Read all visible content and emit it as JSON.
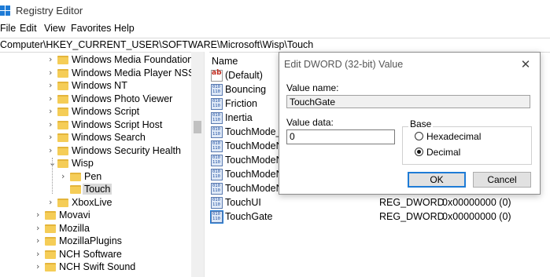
{
  "window": {
    "title": "Registry Editor"
  },
  "menu": [
    "File",
    "Edit",
    "View",
    "Favorites",
    "Help"
  ],
  "address": "Computer\\HKEY_CURRENT_USER\\SOFTWARE\\Microsoft\\Wisp\\Touch",
  "tree": [
    {
      "label": "Windows Media Foundation",
      "expand": "collapsed"
    },
    {
      "label": "Windows Media Player NSS",
      "expand": "collapsed"
    },
    {
      "label": "Windows NT",
      "expand": "collapsed"
    },
    {
      "label": "Windows Photo Viewer",
      "expand": "collapsed"
    },
    {
      "label": "Windows Script",
      "expand": "collapsed"
    },
    {
      "label": "Windows Script Host",
      "expand": "collapsed"
    },
    {
      "label": "Windows Search",
      "expand": "collapsed"
    },
    {
      "label": "Windows Security Health",
      "expand": "collapsed"
    },
    {
      "label": "Wisp",
      "expand": "expanded"
    },
    {
      "label": "Pen",
      "expand": "collapsed"
    },
    {
      "label": "Touch",
      "expand": "none",
      "selected": true
    },
    {
      "label": "XboxLive",
      "expand": "collapsed"
    },
    {
      "label": "Movavi",
      "expand": "collapsed"
    },
    {
      "label": "Mozilla",
      "expand": "collapsed"
    },
    {
      "label": "MozillaPlugins",
      "expand": "collapsed"
    },
    {
      "label": "NCH Software",
      "expand": "collapsed"
    },
    {
      "label": "NCH Swift Sound",
      "expand": "collapsed"
    }
  ],
  "values_pane": {
    "column_name": "Name",
    "rows": [
      {
        "name": "(Default)",
        "icon": "string-value-icon",
        "type": "",
        "data": ""
      },
      {
        "name": "Bouncing",
        "icon": "dword-value-icon",
        "type": "",
        "data": ""
      },
      {
        "name": "Friction",
        "icon": "dword-value-icon",
        "type": "",
        "data": ""
      },
      {
        "name": "Inertia",
        "icon": "dword-value-icon",
        "type": "",
        "data": ""
      },
      {
        "name": "TouchMode_ho",
        "icon": "dword-value-icon",
        "type": "",
        "data": ""
      },
      {
        "name": "TouchModeN_",
        "icon": "dword-value-icon",
        "type": "",
        "data": ""
      },
      {
        "name": "TouchModeN_",
        "icon": "dword-value-icon",
        "type": "",
        "data": ""
      },
      {
        "name": "TouchModeN_",
        "icon": "dword-value-icon",
        "type": "",
        "data": ""
      },
      {
        "name": "TouchModeN_",
        "icon": "dword-value-icon",
        "type": "",
        "data": ""
      },
      {
        "name": "TouchUI",
        "icon": "dword-value-icon",
        "type": "REG_DWORD",
        "data": "0x00000000 (0)"
      },
      {
        "name": "TouchGate",
        "icon": "dword-value-icon",
        "type": "REG_DWORD",
        "data": "0x00000000 (0)",
        "selected": true
      }
    ]
  },
  "dialog": {
    "title": "Edit DWORD (32-bit) Value",
    "value_name_label": "Value name:",
    "value_name": "TouchGate",
    "value_data_label": "Value data:",
    "value_data": "0",
    "base_label": "Base",
    "hex_label": "Hexadecimal",
    "dec_label": "Decimal",
    "base_selected": "Decimal",
    "ok_label": "OK",
    "cancel_label": "Cancel",
    "close_glyph": "✕"
  }
}
